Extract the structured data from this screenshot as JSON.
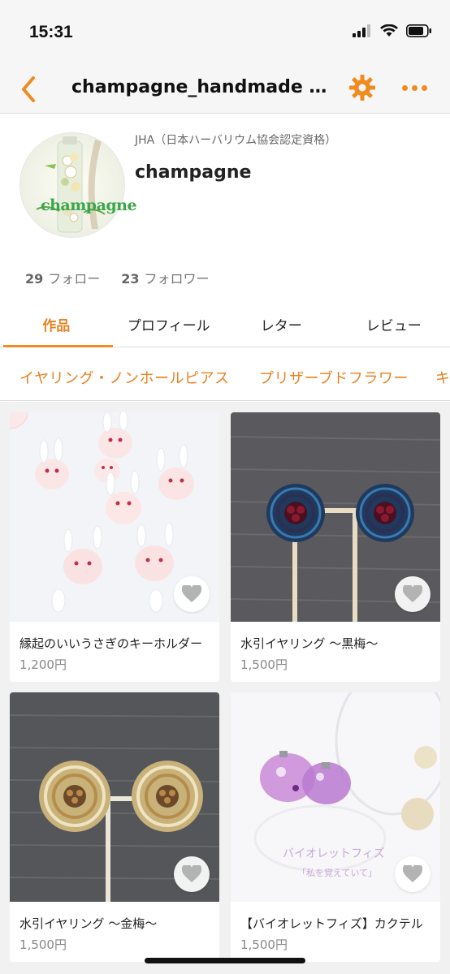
{
  "status_bar": {
    "time": "15:31"
  },
  "nav": {
    "title": "champagne_handmade G...",
    "back_icon": "chevron-left-icon",
    "settings_icon": "gear-icon",
    "more_icon": "more-dots-icon",
    "accent_color": "#f28b1f"
  },
  "profile": {
    "avatar_text": "champagne",
    "subtitle": "JHA（日本ハーバリウム協会認定資格）",
    "name": "champagne",
    "following_count": "29",
    "following_label": "フォロー",
    "followers_count": "23",
    "followers_label": "フォロワー"
  },
  "tabs": [
    {
      "label": "作品",
      "active": true
    },
    {
      "label": "プロフィール",
      "active": false
    },
    {
      "label": "レター",
      "active": false
    },
    {
      "label": "レビュー",
      "active": false
    }
  ],
  "categories": [
    {
      "label": "イヤリング・ノンホールピアス"
    },
    {
      "label": "プリザーブドフラワー"
    },
    {
      "label": "キ"
    }
  ],
  "products": [
    {
      "title": "縁起のいいうさぎのキーホルダー",
      "price": "1,200円",
      "image": "white-rabbit-keychains"
    },
    {
      "title": "水引イヤリング 〜黒梅〜",
      "price": "1,500円",
      "image": "navy-mizuhiki-earrings"
    },
    {
      "title": "水引イヤリング 〜金梅〜",
      "price": "1,500円",
      "image": "gold-mizuhiki-earrings"
    },
    {
      "title": "【バイオレットフィズ】カクテル",
      "price": "1,500円",
      "image": "violet-resin-earrings",
      "overlay_title": "バイオレットフィズ",
      "overlay_subtitle": "「私を覚えていて」"
    }
  ]
}
